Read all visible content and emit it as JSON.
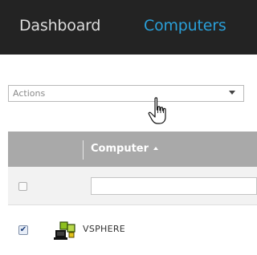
{
  "nav": {
    "tabs": [
      {
        "label": "Dashboard",
        "active": false
      },
      {
        "label": "Computers",
        "active": true
      }
    ]
  },
  "actions": {
    "label": "Actions"
  },
  "grid": {
    "column_header": "Computer",
    "sort": "ascending",
    "filter_value": "",
    "rows": [
      {
        "name": "VSPHERE",
        "checked": true,
        "icon": "network-computer-icon"
      }
    ]
  },
  "colors": {
    "nav_bg": "#232323",
    "active_tab": "#2a9fd8",
    "header_bg": "#a9a9a9"
  }
}
